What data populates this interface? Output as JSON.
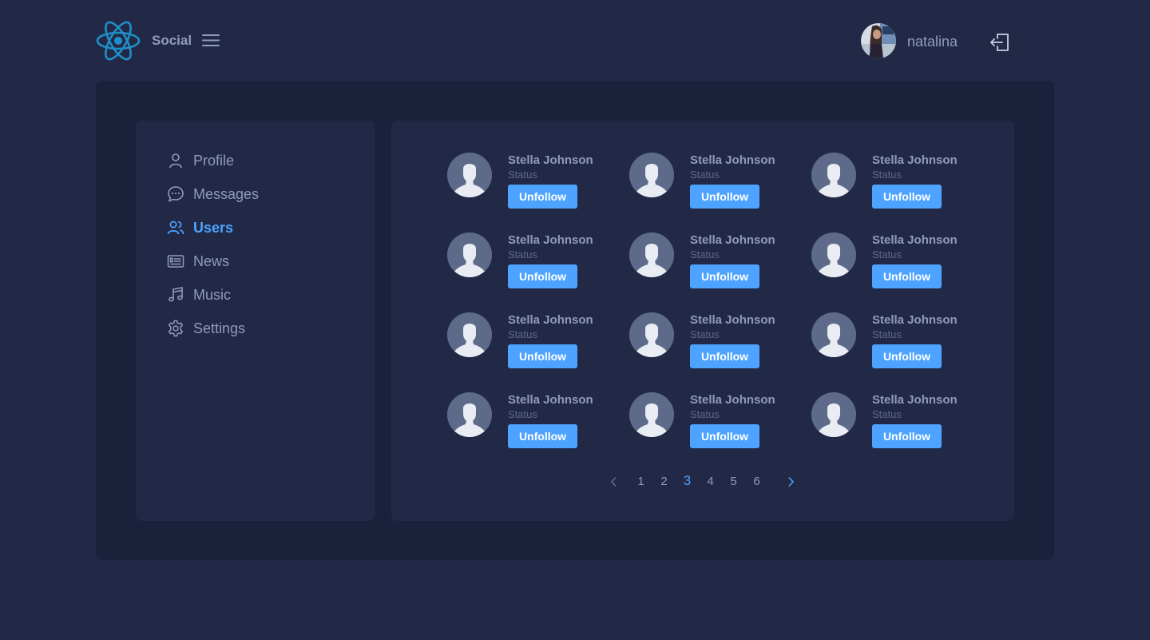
{
  "header": {
    "brand": "Social",
    "username": "natalina"
  },
  "colors": {
    "background": "#222946",
    "panel": "#1b213b",
    "text": "#8f9bbd",
    "accent": "#4da3ff",
    "logo": "#1f8fc8"
  },
  "sidebar": {
    "items": [
      {
        "label": "Profile",
        "icon": "user-icon",
        "active": false
      },
      {
        "label": "Messages",
        "icon": "chat-icon",
        "active": false
      },
      {
        "label": "Users",
        "icon": "users-icon",
        "active": true
      },
      {
        "label": "News",
        "icon": "newspaper-icon",
        "active": false
      },
      {
        "label": "Music",
        "icon": "music-icon",
        "active": false
      },
      {
        "label": "Settings",
        "icon": "gear-icon",
        "active": false
      }
    ]
  },
  "users": [
    {
      "name": "Stella Johnson",
      "status": "Status",
      "button": "Unfollow"
    },
    {
      "name": "Stella Johnson",
      "status": "Status",
      "button": "Unfollow"
    },
    {
      "name": "Stella Johnson",
      "status": "Status",
      "button": "Unfollow"
    },
    {
      "name": "Stella Johnson",
      "status": "Status",
      "button": "Unfollow"
    },
    {
      "name": "Stella Johnson",
      "status": "Status",
      "button": "Unfollow"
    },
    {
      "name": "Stella Johnson",
      "status": "Status",
      "button": "Unfollow"
    },
    {
      "name": "Stella Johnson",
      "status": "Status",
      "button": "Unfollow"
    },
    {
      "name": "Stella Johnson",
      "status": "Status",
      "button": "Unfollow"
    },
    {
      "name": "Stella Johnson",
      "status": "Status",
      "button": "Unfollow"
    },
    {
      "name": "Stella Johnson",
      "status": "Status",
      "button": "Unfollow"
    },
    {
      "name": "Stella Johnson",
      "status": "Status",
      "button": "Unfollow"
    },
    {
      "name": "Stella Johnson",
      "status": "Status",
      "button": "Unfollow"
    }
  ],
  "pagination": {
    "pages": [
      "1",
      "2",
      "3",
      "4",
      "5",
      "6"
    ],
    "current": "3"
  }
}
